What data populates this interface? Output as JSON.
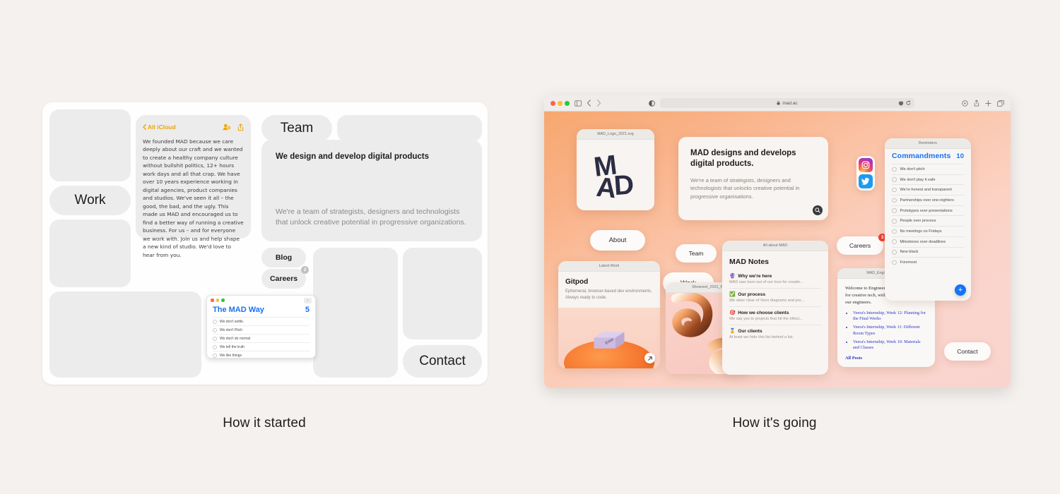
{
  "captions": {
    "left": "How it started",
    "right": "How it's going"
  },
  "left_panel": {
    "pills": {
      "work": "Work",
      "team": "Team",
      "blog": "Blog",
      "careers": "Careers",
      "careers_badge": "2",
      "contact": "Contact"
    },
    "notes_card": {
      "back_label": "All iCloud",
      "icons": [
        "add-people-icon",
        "share-icon"
      ],
      "body": "We founded MAD because we care deeply about our craft and we wanted to create a healthy company culture without bullshit politics, 12+ hours work days and all that crap. We have over 10 years experience working in digital agencies, product companies and studios. We've seen it all – the good, the bad, and the ugly. This made us MAD and encouraged us to find a better way of running a creative business. For us – and for everyone we work with. Join us and help shape a new kind of studio. We'd love to hear from you."
    },
    "headline": {
      "title": "We design and develop digital products",
      "subtitle": "We're a team of strategists, designers and technologists that unlock creative potential in progressive organizations."
    },
    "reminders": {
      "title": "The MAD Way",
      "count": "5",
      "items": [
        "We don't settle.",
        "We don't Pitch",
        "We don't do normal",
        "We tell the truth",
        "We like things"
      ]
    }
  },
  "browser": {
    "url": "mad.ac",
    "lock_icon": "lock-icon",
    "toolbar_left": [
      "traffic-lights",
      "sidebar-icon",
      "back-icon",
      "forward-icon"
    ],
    "toolbar_right": [
      "extensions-icon",
      "share-icon",
      "new-tab-icon",
      "tabs-icon"
    ],
    "reader_icon": "reader-icon"
  },
  "site": {
    "logo_card": {
      "title": "MAD_Logo_2021.svg",
      "wordmark": "MAD"
    },
    "hero": {
      "heading": "MAD designs and develops digital products.",
      "body": "We're a team of strategists, designers and technologists that unlocks creative potential in progressive organisations.",
      "fab_icon": "search-icon"
    },
    "pills": {
      "about": "About",
      "team": "Team",
      "work": "Work",
      "careers": "Careers",
      "careers_badge": "3",
      "contact": "Contact"
    },
    "work_card": {
      "title": "Latest Work",
      "heading": "Gitpod",
      "body": "Ephemeral, browser-based dev environments. Always ready to code.",
      "key_label": "Enter",
      "fab_icon": "arrow-up-right-icon"
    },
    "showreel_card": {
      "title": "Showreel_2021_F",
      "fab_icon": "play-icon"
    },
    "notes_card": {
      "title": "All about MAD",
      "heading": "MAD Notes",
      "rows": [
        {
          "emoji": "🔮",
          "title": "Why we're here",
          "sub": "MAD was born out of our love for creatin..."
        },
        {
          "emoji": "✅",
          "title": "Our process",
          "sub": "We steer clear of Venn diagrams and pro..."
        },
        {
          "emoji": "🎯",
          "title": "How we choose clients",
          "sub": "We say yes to projects that hit the trifect..."
        },
        {
          "emoji": "🏅",
          "title": "Our clients",
          "sub": "At least we hide this list behind a list."
        }
      ]
    },
    "engineering_card": {
      "title": "MAD_Engineering.html",
      "intro": "Welcome to Engineering at MAD. A space for creative tech, with words directly from our engineers.",
      "links": [
        "Veera's Internship, Week 12: Planning for the Final Weeks",
        "Veera's Internship, Week 11: Different Room Types",
        "Veera's Internship, Week 10: Materials and Classes"
      ],
      "all_posts": "All Posts"
    },
    "commandments": {
      "title_bar": "Reminders",
      "heading": "Commandments",
      "count": "10",
      "items": [
        "We don't pitch",
        "We don't play it safe",
        "We're honest and transparent",
        "Partnerships over one-nighters",
        "Prototypes over presentations",
        "People over process",
        "No meetings on Fridays",
        "Milestones over deadlines",
        "New black",
        "Foremost"
      ],
      "add_label": "+"
    },
    "social": [
      {
        "name": "instagram-icon"
      },
      {
        "name": "twitter-icon"
      }
    ]
  },
  "colors": {
    "page_bg": "#f5f1ee",
    "accent_blue": "#1573f5",
    "accent_orange": "#f0a500",
    "badge_red": "#f03e2f",
    "gradient_start": "#f7a870",
    "gradient_end": "#f9d4ce"
  }
}
